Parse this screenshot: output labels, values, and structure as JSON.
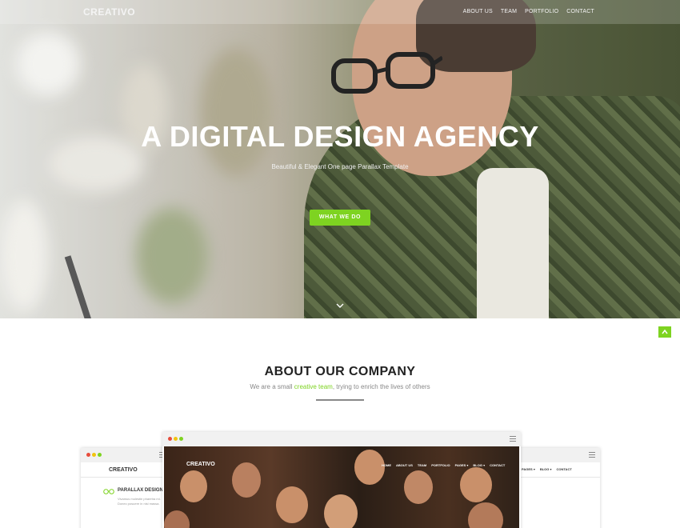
{
  "nav": {
    "brand": "CREATIVO",
    "items": [
      "ABOUT US",
      "TEAM",
      "PORTFOLIO",
      "CONTACT"
    ]
  },
  "hero": {
    "title": "A DIGITAL DESIGN AGENCY",
    "subtitle": "Beautiful & Elegant One page Parallax Template",
    "button_label": "WHAT WE DO",
    "scroll_icon": "chevron-down-icon"
  },
  "back_to_top_icon": "chevron-up-icon",
  "about": {
    "title": "ABOUT OUR COMPANY",
    "subtitle_before": "We are a small ",
    "subtitle_accent": "creative team",
    "subtitle_after": ", trying to enrich the lives of others"
  },
  "mockups": {
    "left": {
      "brand": "CREATIVO",
      "heading": "PARALLAX DESIGN",
      "text": "Vivamus molestie pharetra mi. Donec posuere in nisl massa."
    },
    "center": {
      "brand": "CREATIVO",
      "nav": [
        "HOME",
        "ABOUT US",
        "TEAM",
        "PORTFOLIO",
        "PAGES ▾",
        "BLOG ▾",
        "CONTACT"
      ]
    },
    "right": {
      "nav": [
        "PAGES ▾",
        "BLOG ▾",
        "CONTACT"
      ]
    }
  },
  "colors": {
    "accent": "#7ed321",
    "dot_red": "#e74c3c",
    "dot_yellow": "#f1c40f",
    "dot_green": "#7ed321"
  }
}
